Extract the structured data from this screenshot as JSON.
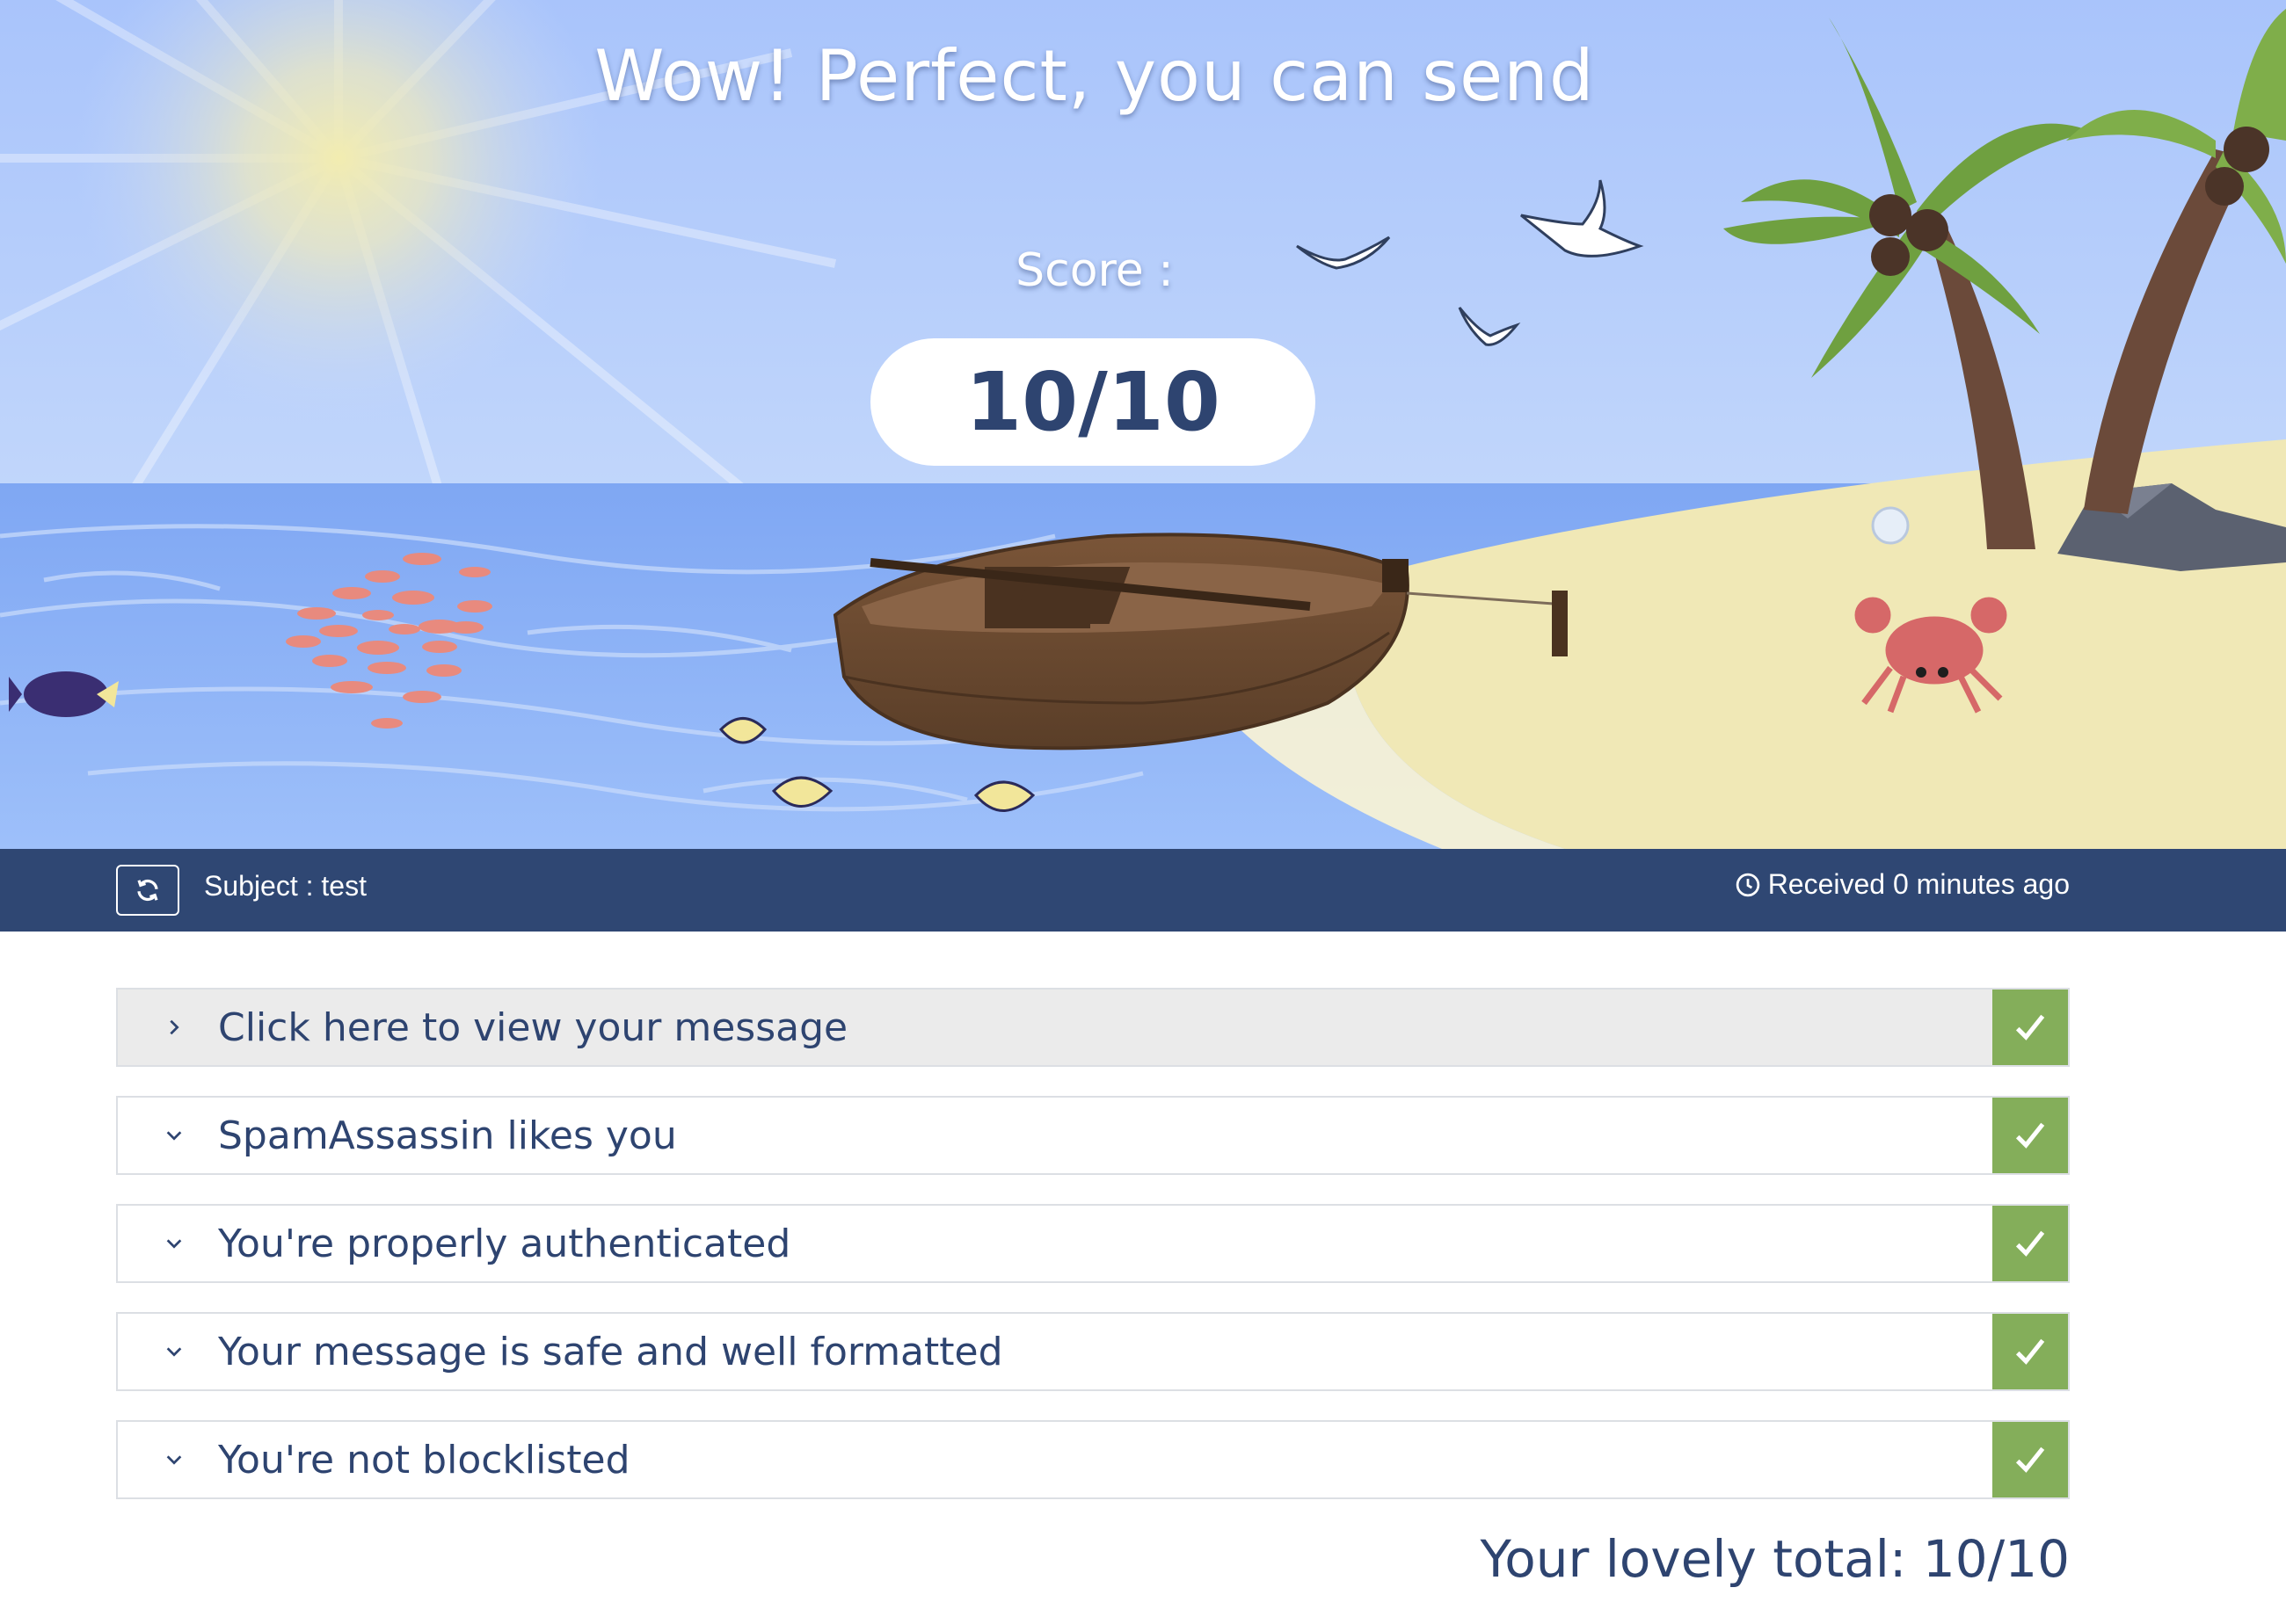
{
  "hero": {
    "title": "Wow! Perfect, you can send",
    "score_label": "Score :",
    "score_value": "10/10"
  },
  "subject_bar": {
    "refresh_icon": "refresh-icon",
    "subject": "Subject : test",
    "received_icon": "clock-icon",
    "received": "Received 0 minutes ago"
  },
  "sections": [
    {
      "label": "Click here to view your message",
      "expanded": false,
      "status": "pass"
    },
    {
      "label": "SpamAssassin likes you",
      "expanded": true,
      "status": "pass"
    },
    {
      "label": "You're properly authenticated",
      "expanded": true,
      "status": "pass"
    },
    {
      "label": "Your message is safe and well formatted",
      "expanded": true,
      "status": "pass"
    },
    {
      "label": "You're not blocklisted",
      "expanded": true,
      "status": "pass"
    }
  ],
  "total": "Your lovely total: 10/10",
  "colors": {
    "navy": "#2f4773",
    "text": "#2e4470",
    "pass_green": "#84ae5a",
    "sky": "#aec8fb",
    "sea": "#8fb3f5",
    "sand": "#f0e8b6"
  }
}
